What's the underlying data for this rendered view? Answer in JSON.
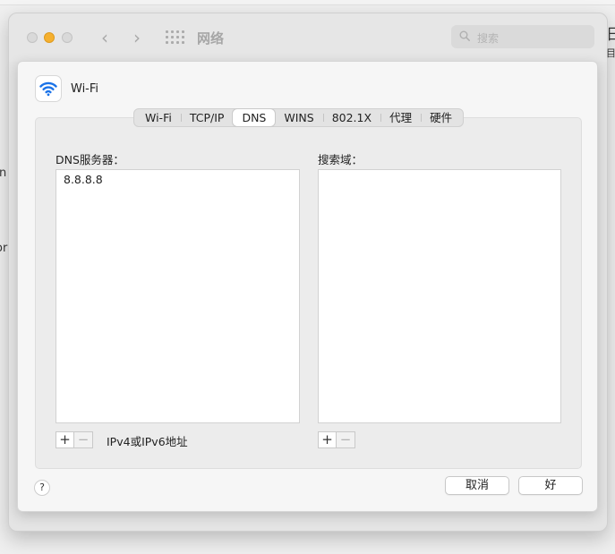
{
  "window": {
    "title": "网络",
    "search_placeholder": "搜索",
    "back_icon": "chevron-left-icon",
    "forward_icon": "chevron-right-icon",
    "grid_icon": "grid-icon",
    "edge_texts": [
      "日",
      "目",
      "n",
      "or"
    ]
  },
  "sheet": {
    "service_icon": "wifi-icon",
    "service_name": "Wi-Fi",
    "tabs": [
      "Wi-Fi",
      "TCP/IP",
      "DNS",
      "WINS",
      "802.1X",
      "代理",
      "硬件"
    ],
    "active_tab": "DNS",
    "dns": {
      "label": "DNS服务器：",
      "servers": [
        "8.8.8.8"
      ],
      "add_label": "+",
      "remove_label": "−",
      "hint": "IPv4或IPv6地址"
    },
    "search_domains": {
      "label": "搜索域：",
      "entries": [],
      "add_label": "+",
      "remove_label": "−"
    },
    "help_label": "?",
    "cancel_label": "取消",
    "ok_label": "好"
  },
  "colors": {
    "accent_blue": "#1b73e8",
    "traffic_minimize": "#f5b02f"
  }
}
